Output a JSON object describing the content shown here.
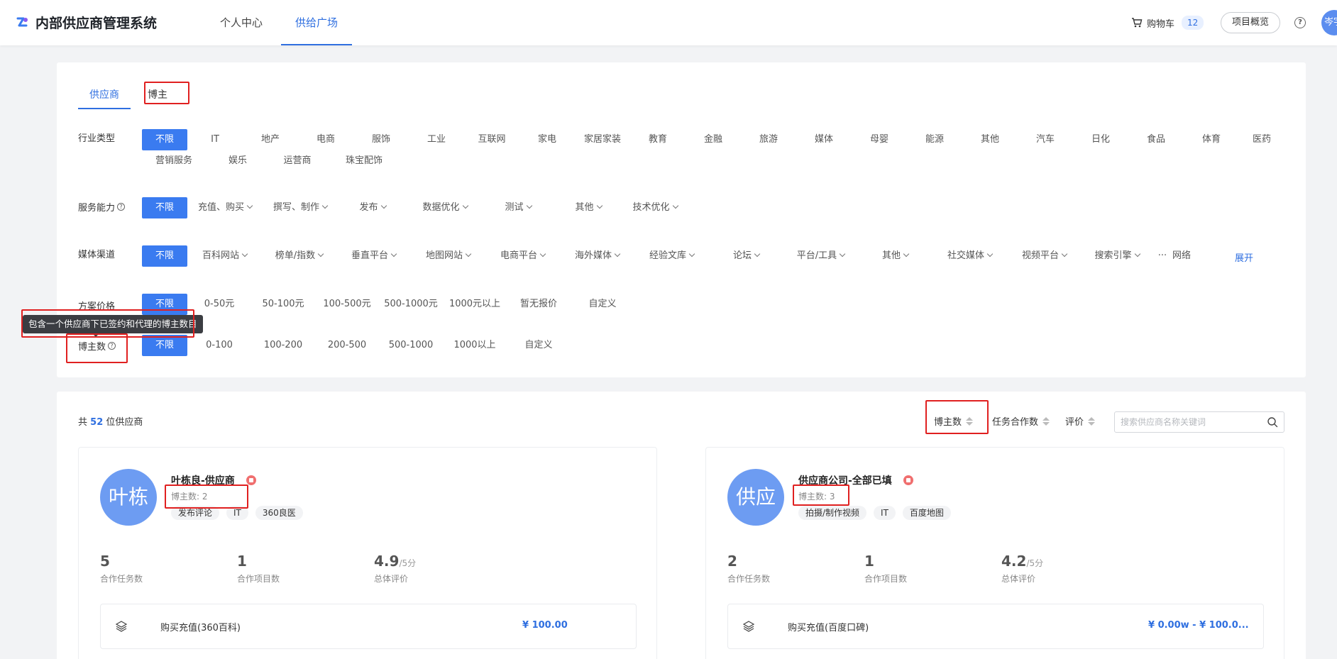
{
  "header": {
    "app_title": "内部供应商管理系统",
    "nav": [
      {
        "label": "个人中心"
      },
      {
        "label": "供给广场"
      }
    ],
    "cart_label": "购物车",
    "cart_count": "12",
    "overview_label": "项目概览",
    "help_glyph": "?",
    "avatar_text": "岑宇"
  },
  "tabs": [
    {
      "label": "供应商"
    },
    {
      "label": "博主"
    }
  ],
  "filters": {
    "industry": {
      "label": "行业类型",
      "options": [
        "不限",
        "IT",
        "地产",
        "电商",
        "服饰",
        "工业",
        "互联网",
        "家电",
        "家居家装",
        "教育",
        "金融",
        "旅游",
        "媒体",
        "母婴",
        "能源",
        "其他",
        "汽车",
        "日化",
        "食品",
        "体育",
        "医药",
        "营销服务",
        "娱乐",
        "运营商",
        "珠宝配饰"
      ]
    },
    "service": {
      "label": "服务能力",
      "options": [
        "不限",
        "充值、购买",
        "撰写、制作",
        "发布",
        "数据优化",
        "测试",
        "其他",
        "技术优化"
      ]
    },
    "media": {
      "label": "媒体渠道",
      "options": [
        "不限",
        "百科网站",
        "榜单/指数",
        "垂直平台",
        "地图网站",
        "电商平台",
        "海外媒体",
        "经验文库",
        "论坛",
        "平台/工具",
        "其他",
        "社交媒体",
        "视频平台",
        "搜索引擎",
        "···",
        "网</span>"
      ],
      "expand_label": "展开"
    },
    "price": {
      "label": "方案价格",
      "options": [
        "不限",
        "0-50元",
        "50-100元",
        "100-500元",
        "500-1000元",
        "1000元以上",
        "暂无报价",
        "自定义"
      ]
    },
    "bloggers": {
      "label": "博主数",
      "options": [
        "不限",
        "0-100",
        "100-200",
        "200-500",
        "500-1000",
        "1000以上",
        "自定义"
      ],
      "tooltip": "包含一个供应商下已签约和代理的博主数目"
    }
  },
  "results": {
    "total_prefix": "共",
    "total_count": "52",
    "total_suffix": "位供应商",
    "sort": [
      {
        "label": "博主数"
      },
      {
        "label": "任务合作数"
      },
      {
        "label": "评价"
      }
    ],
    "search_placeholder": "搜索供应商名称关键词",
    "suppliers": [
      {
        "avatar_text": "叶栋",
        "name": "叶栋良-供应商",
        "blogger_label": "博主数:",
        "blogger_count": "2",
        "tags": [
          "发布评论",
          "IT",
          "360良医"
        ],
        "stats": [
          {
            "value": "5",
            "unit": "",
            "label": "合作任务数"
          },
          {
            "value": "1",
            "unit": "",
            "label": "合作项目数"
          },
          {
            "value": "4.9",
            "unit": "/5分",
            "label": "总体评价"
          }
        ],
        "plan_name": "购买充值(360百科)",
        "plan_price": "¥ 100.00"
      },
      {
        "avatar_text": "供应",
        "name": "供应商公司-全部已填",
        "blogger_label": "博主数:",
        "blogger_count": "3",
        "tags": [
          "拍摄/制作视频",
          "IT",
          "百度地图"
        ],
        "stats": [
          {
            "value": "2",
            "unit": "",
            "label": "合作任务数"
          },
          {
            "value": "1",
            "unit": "",
            "label": "合作项目数"
          },
          {
            "value": "4.2",
            "unit": "/5分",
            "label": "总体评价"
          }
        ],
        "plan_name": "购买充值(百度口碑)",
        "plan_price": "¥ 0.00w - ¥ 100.0..."
      }
    ]
  },
  "colors": {
    "accent": "#2f6fe0",
    "highlight_box": "#e02020",
    "avatar": "#6d9cf2"
  }
}
